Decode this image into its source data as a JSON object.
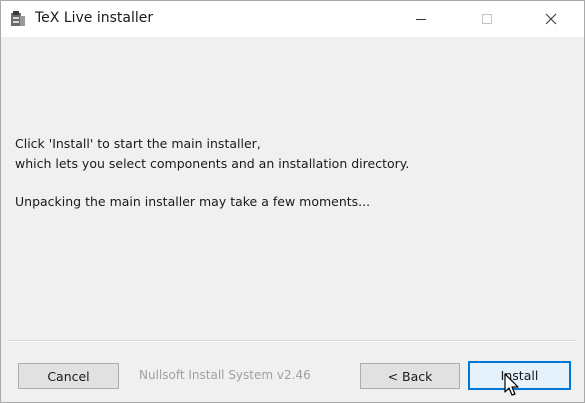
{
  "window": {
    "title": "TeX Live installer",
    "app_icon": "tex-live-installer-icon"
  },
  "titlebar_controls": {
    "minimize_icon": "minimize-icon",
    "maximize_icon": "maximize-icon",
    "close_icon": "close-icon"
  },
  "content": {
    "line1": "Click 'Install' to start the main installer,",
    "line2": "which lets you select components and an installation directory.",
    "line3": "Unpacking the main installer may take a few moments..."
  },
  "footer": {
    "cancel_label": "Cancel",
    "branding": "Nullsoft Install System v2.46",
    "back_label": "< Back",
    "install_label": "Install"
  },
  "colors": {
    "focus_border": "#0078d7",
    "dialog_bg": "#f0f0f0",
    "titlebar_bg": "#ffffff"
  }
}
